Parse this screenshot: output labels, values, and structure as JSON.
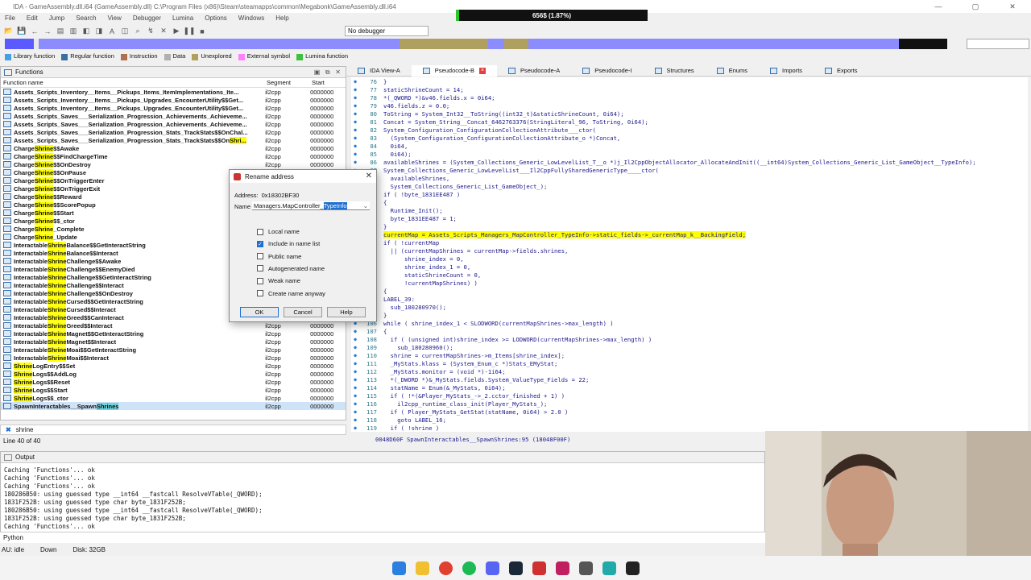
{
  "window": {
    "title": "IDA - GameAssembly.dll.i64 (GameAssembly.dll) C:\\Program Files (x86)\\Steam\\steamapps\\common\\Megabonk\\GameAssembly.dll.i64",
    "progress_text": "656$ (1.87%)",
    "progress": 0.0187
  },
  "menu": [
    "File",
    "Edit",
    "Jump",
    "Search",
    "View",
    "Debugger",
    "Lumina",
    "Options",
    "Windows",
    "Help"
  ],
  "toolbar": {
    "debugger_select": "No debugger"
  },
  "legend": [
    {
      "label": "Library function",
      "color": "#46a0e8"
    },
    {
      "label": "Regular function",
      "color": "#3a6ea5"
    },
    {
      "label": "Instruction",
      "color": "#b07050"
    },
    {
      "label": "Data",
      "color": "#b0b0b0"
    },
    {
      "label": "Unexplored",
      "color": "#b0a060"
    },
    {
      "label": "External symbol",
      "color": "#ff80ff"
    },
    {
      "label": "Lumina function",
      "color": "#40c040"
    }
  ],
  "functions": {
    "title": "Functions",
    "columns": {
      "name": "Function name",
      "segment": "Segment",
      "start": "Start"
    },
    "rows": [
      {
        "pre": "Assets_Scripts_Inventory__Items__Pickups_Items_ItemImplementations_Ite...",
        "hl": "",
        "post": "",
        "seg": "il2cpp",
        "start": "0000000"
      },
      {
        "pre": "Assets_Scripts_Inventory__Items__Pickups_Upgrades_EncounterUtility$$Get...",
        "hl": "",
        "post": "",
        "seg": "il2cpp",
        "start": "0000000"
      },
      {
        "pre": "Assets_Scripts_Inventory__Items__Pickups_Upgrades_EncounterUtility$$Get...",
        "hl": "",
        "post": "",
        "seg": "il2cpp",
        "start": "0000000"
      },
      {
        "pre": "Assets_Scripts_Saves___Serialization_Progression_Achievements_Achieveme...",
        "hl": "",
        "post": "",
        "seg": "il2cpp",
        "start": "0000000"
      },
      {
        "pre": "Assets_Scripts_Saves___Serialization_Progression_Achievements_Achieveme...",
        "hl": "",
        "post": "",
        "seg": "il2cpp",
        "start": "0000000"
      },
      {
        "pre": "Assets_Scripts_Saves___Serialization_Progression_Stats_TrackStats$$OnChal...",
        "hl": "",
        "post": "",
        "seg": "il2cpp",
        "start": "0000000"
      },
      {
        "pre": "Assets_Scripts_Saves___Serialization_Progression_Stats_TrackStats$$On",
        "hl": "Shri...",
        "post": "",
        "seg": "il2cpp",
        "start": "0000000"
      },
      {
        "pre": "Charge",
        "hl": "Shrine",
        "post": "$$Awake",
        "seg": "il2cpp",
        "start": "0000000"
      },
      {
        "pre": "Charge",
        "hl": "Shrine",
        "post": "$$FindChargeTime",
        "seg": "il2cpp",
        "start": "0000000"
      },
      {
        "pre": "Charge",
        "hl": "Shrine",
        "post": "$$OnDestroy",
        "seg": "il2cpp",
        "start": "0000000"
      },
      {
        "pre": "Charge",
        "hl": "Shrine",
        "post": "$$OnPause",
        "seg": "il2cpp",
        "start": "0000000"
      },
      {
        "pre": "Charge",
        "hl": "Shrine",
        "post": "$$OnTriggerEnter",
        "seg": "il2cpp",
        "start": "0000000"
      },
      {
        "pre": "Charge",
        "hl": "Shrine",
        "post": "$$OnTriggerExit",
        "seg": "il2cpp",
        "start": "0000000"
      },
      {
        "pre": "Charge",
        "hl": "Shrine",
        "post": "$$Reward",
        "seg": "il2cpp",
        "start": "0000000"
      },
      {
        "pre": "Charge",
        "hl": "Shrine",
        "post": "$$ScorePopup",
        "seg": "il2cpp",
        "start": "0000000"
      },
      {
        "pre": "Charge",
        "hl": "Shrine",
        "post": "$$Start",
        "seg": "il2cpp",
        "start": "0000000"
      },
      {
        "pre": "Charge",
        "hl": "Shrine",
        "post": "$$_ctor",
        "seg": "il2cpp",
        "start": "0000000"
      },
      {
        "pre": "Charge",
        "hl": "Shrine",
        "post": "_Complete",
        "seg": "il2cpp",
        "start": "0000000"
      },
      {
        "pre": "Charge",
        "hl": "Shrine",
        "post": "_Update",
        "seg": "il2cpp",
        "start": "0000000"
      },
      {
        "pre": "Interactable",
        "hl": "Shrine",
        "post": "Balance$$GetInteractString",
        "seg": "il2cpp",
        "start": "0000000"
      },
      {
        "pre": "Interactable",
        "hl": "Shrine",
        "post": "Balance$$Interact",
        "seg": "il2cpp",
        "start": "0000000"
      },
      {
        "pre": "Interactable",
        "hl": "Shrine",
        "post": "Challenge$$Awake",
        "seg": "il2cpp",
        "start": "0000000"
      },
      {
        "pre": "Interactable",
        "hl": "Shrine",
        "post": "Challenge$$EnemyDied",
        "seg": "il2cpp",
        "start": "0000000"
      },
      {
        "pre": "Interactable",
        "hl": "Shrine",
        "post": "Challenge$$GetInteractString",
        "seg": "il2cpp",
        "start": "0000000"
      },
      {
        "pre": "Interactable",
        "hl": "Shrine",
        "post": "Challenge$$Interact",
        "seg": "il2cpp",
        "start": "0000000"
      },
      {
        "pre": "Interactable",
        "hl": "Shrine",
        "post": "Challenge$$OnDestroy",
        "seg": "il2cpp",
        "start": "0000000"
      },
      {
        "pre": "Interactable",
        "hl": "Shrine",
        "post": "Cursed$$GetInteractString",
        "seg": "il2cpp",
        "start": "0000000"
      },
      {
        "pre": "Interactable",
        "hl": "Shrine",
        "post": "Cursed$$Interact",
        "seg": "il2cpp",
        "start": "0000000"
      },
      {
        "pre": "Interactable",
        "hl": "Shrine",
        "post": "Greed$$CanInteract",
        "seg": "il2cpp",
        "start": "0000000"
      },
      {
        "pre": "Interactable",
        "hl": "Shrine",
        "post": "Greed$$Interact",
        "seg": "il2cpp",
        "start": "0000000"
      },
      {
        "pre": "Interactable",
        "hl": "Shrine",
        "post": "Magnet$$GetInteractString",
        "seg": "il2cpp",
        "start": "0000000"
      },
      {
        "pre": "Interactable",
        "hl": "Shrine",
        "post": "Magnet$$Interact",
        "seg": "il2cpp",
        "start": "0000000"
      },
      {
        "pre": "Interactable",
        "hl": "Shrine",
        "post": "Moai$$GetInteractString",
        "seg": "il2cpp",
        "start": "0000000"
      },
      {
        "pre": "Interactable",
        "hl": "Shrine",
        "post": "Moai$$Interact",
        "seg": "il2cpp",
        "start": "0000000"
      },
      {
        "pre": "",
        "hl": "Shrine",
        "post": "LogEntry$$Set",
        "seg": "il2cpp",
        "start": "0000000"
      },
      {
        "pre": "",
        "hl": "Shrine",
        "post": "Logs$$AddLog",
        "seg": "il2cpp",
        "start": "0000000"
      },
      {
        "pre": "",
        "hl": "Shrine",
        "post": "Logs$$Reset",
        "seg": "il2cpp",
        "start": "0000000"
      },
      {
        "pre": "",
        "hl": "Shrine",
        "post": "Logs$$Start",
        "seg": "il2cpp",
        "start": "0000000"
      },
      {
        "pre": "",
        "hl": "Shrine",
        "post": "Logs$$_ctor",
        "seg": "il2cpp",
        "start": "0000000"
      },
      {
        "pre": "SpawnInteractables__Spawn",
        "hl": "Shrines",
        "post": "",
        "seg": "il2cpp",
        "start": "0000000",
        "selected": true
      }
    ],
    "filter": "shrine",
    "line_status": "Line 40 of 40"
  },
  "tabs": [
    {
      "label": "IDA View-A"
    },
    {
      "label": "Pseudocode-B",
      "active": true
    },
    {
      "label": "Pseudocode-A"
    },
    {
      "label": "Pseudocode-I"
    },
    {
      "label": "Structures"
    },
    {
      "label": "Enums"
    },
    {
      "label": "Imports"
    },
    {
      "label": "Exports"
    }
  ],
  "code": [
    {
      "n": "76",
      "t": "}"
    },
    {
      "n": "77",
      "t": "staticShrineCount = 14;"
    },
    {
      "n": "78",
      "t": "*(_QWORD *)&v46.fields.x = 0i64;"
    },
    {
      "n": "79",
      "t": "v46.fields.z = 0.0;"
    },
    {
      "n": "80",
      "t": "ToString = System_Int32__ToString((int32_t)&staticShrineCount, 0i64);"
    },
    {
      "n": "81",
      "t": "Concat = System_String__Concat_6462763376(StringLiteral_96, ToString, 0i64);"
    },
    {
      "n": "82",
      "t": "System_Configuration_ConfigurationCollectionAttribute___ctor("
    },
    {
      "n": "83",
      "t": "  (System_Configuration_ConfigurationCollectionAttribute_o *)Concat,"
    },
    {
      "n": "84",
      "t": "  0i64,"
    },
    {
      "n": "85",
      "t": "  0i64);"
    },
    {
      "n": "86",
      "t": "availableShrines = (System_Collections_Generic_LowLevelList_T__o *)j_Il2CppObjectAllocator_AllocateAndInit((__int64)System_Collections_Generic_List_GameObject__TypeInfo);"
    },
    {
      "n": "87",
      "t": "System_Collections_Generic_LowLevelList___Il2CppFullySharedGenericType____ctor("
    },
    {
      "n": "88",
      "t": "  availableShrines,"
    },
    {
      "n": "89",
      "t": "  System_Collections_Generic_List_GameObject_);"
    },
    {
      "n": "90",
      "t": "if ( !byte_1831EE487 )"
    },
    {
      "n": "91",
      "t": "{"
    },
    {
      "n": "92",
      "t": "  Runtime_Init();"
    },
    {
      "n": "93",
      "t": "  byte_1831EE487 = 1;"
    },
    {
      "n": "94",
      "t": "}"
    },
    {
      "n": "95",
      "t": "currentMap = Assets_Scripts_Managers_MapController_TypeInfo->static_fields->_currentMap_k__BackingField;",
      "hl": true
    },
    {
      "n": "96",
      "t": "if ( !currentMap"
    },
    {
      "n": "97",
      "t": "  || (currentMapShrines = currentMap->fields.shrines,"
    },
    {
      "n": "98",
      "t": "      shrine_index = 0,"
    },
    {
      "n": "99",
      "t": "      shrine_index_1 = 0,"
    },
    {
      "n": "100",
      "t": "      staticShrineCount = 0,"
    },
    {
      "n": "101",
      "t": "      !currentMapShrines) )"
    },
    {
      "n": "102",
      "t": "{"
    },
    {
      "n": "103",
      "t": "LABEL_39:"
    },
    {
      "n": "104",
      "t": "  sub_180280970();"
    },
    {
      "n": "105",
      "t": "}"
    },
    {
      "n": "106",
      "t": "while ( shrine_index_1 < SLODWORD(currentMapShrines->max_length) )"
    },
    {
      "n": "107",
      "t": "{"
    },
    {
      "n": "108",
      "t": "  if ( (unsigned int)shrine_index >= LODWORD(currentMapShrines->max_length) )"
    },
    {
      "n": "109",
      "t": "    sub_180280960();"
    },
    {
      "n": "110",
      "t": "  shrine = currentMapShrines->m_Items[shrine_index];"
    },
    {
      "n": "111",
      "t": "  _MyStats.klass = (System_Enum_c *)Stats_EMyStat;"
    },
    {
      "n": "112",
      "t": "  _MyStats.monitor = (void *)-1i64;"
    },
    {
      "n": "113",
      "t": "  *(_DWORD *)&_MyStats.fields.System_ValueType_Fields = 22;"
    },
    {
      "n": "114",
      "t": "  statName = Enum(&_MyStats, 0i64);"
    },
    {
      "n": "115",
      "t": "  if ( !*(&Player_MyStats_->_2.cctor_finished + 1) )"
    },
    {
      "n": "116",
      "t": "    il2cpp_runtime_class_init(Player_MyStats_);"
    },
    {
      "n": "117",
      "t": "  if ( Player_MyStats_GetStat(statName, 0i64) > 2.0 )"
    },
    {
      "n": "118",
      "t": "    goto LABEL_16;"
    },
    {
      "n": "119",
      "t": "  if ( !shrine )"
    }
  ],
  "code_status": "0048D60F SpawnInteractables__SpawnShrines:95 (18048F00F)",
  "output": {
    "title": "Output",
    "lines": [
      "Caching 'Functions'... ok",
      "Caching 'Functions'... ok",
      "Caching 'Functions'... ok",
      "180286B50: using guessed type __int64 __fastcall ResolveVTable(_QWORD);",
      "1831F252B: using guessed type char byte_1831F252B;",
      "180286B50: using guessed type __int64 __fastcall ResolveVTable(_QWORD);",
      "1831F252B: using guessed type char byte_1831F252B;",
      "Caching 'Functions'... ok"
    ],
    "lang": "Python"
  },
  "status": {
    "au": "AU:  idle",
    "dir": "Down",
    "disk": "Disk: 32GB"
  },
  "dialog": {
    "title": "Rename address",
    "address_label": "Address:",
    "address": "0x18302BF30",
    "name_label": "Name",
    "name_prefix": "Managers.MapController_",
    "name_selected": "TypeInfo",
    "options": [
      {
        "label": "Local name",
        "checked": false
      },
      {
        "label": "Include in name list",
        "checked": true
      },
      {
        "label": "Public name",
        "checked": false
      },
      {
        "label": "Autogenerated name",
        "checked": false
      },
      {
        "label": "Weak name",
        "checked": false
      },
      {
        "label": "Create name anyway",
        "checked": false
      }
    ],
    "ok": "OK",
    "cancel": "Cancel",
    "help": "Help"
  }
}
